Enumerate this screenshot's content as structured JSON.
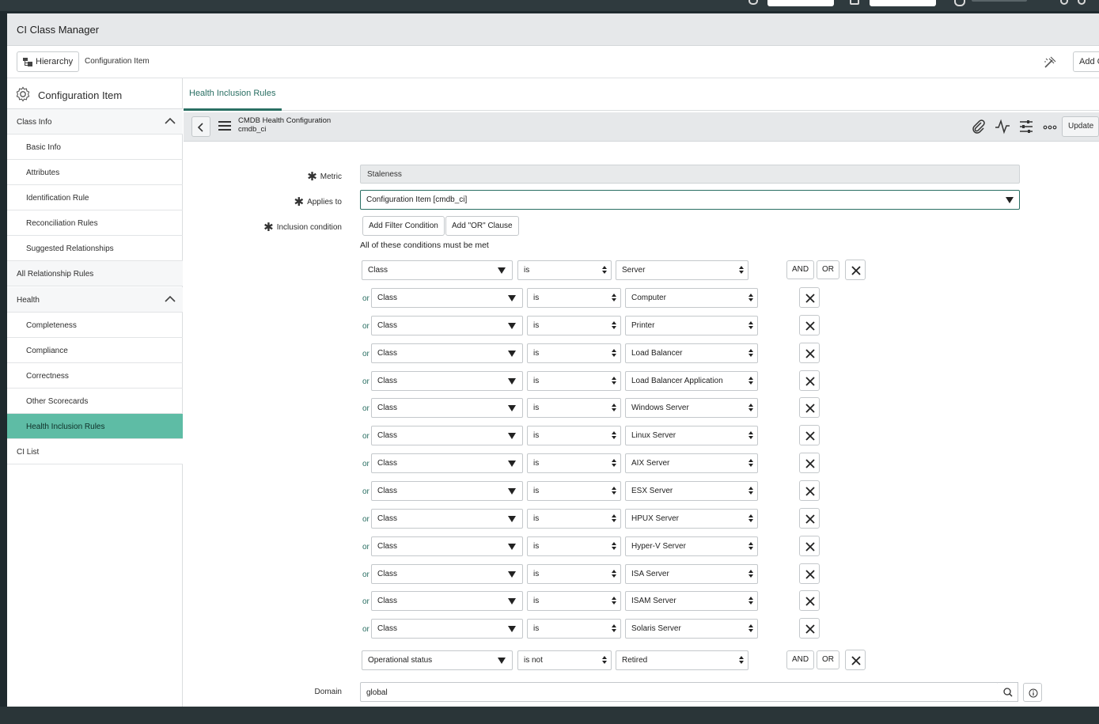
{
  "app": {
    "title": "CI Class Manager"
  },
  "breadcrumb": {
    "hierarchy_label": "Hierarchy",
    "current": "Configuration Item",
    "add_button": "Add C"
  },
  "sidebar": {
    "header": "Configuration Item",
    "items": [
      {
        "label": "Class Info",
        "type": "section",
        "expanded": true
      },
      {
        "label": "Basic Info",
        "type": "sub"
      },
      {
        "label": "Attributes",
        "type": "sub"
      },
      {
        "label": "Identification Rule",
        "type": "sub"
      },
      {
        "label": "Reconciliation Rules",
        "type": "sub"
      },
      {
        "label": "Suggested Relationships",
        "type": "sub"
      },
      {
        "label": "All Relationship Rules",
        "type": "section"
      },
      {
        "label": "Health",
        "type": "section",
        "expanded": true
      },
      {
        "label": "Completeness",
        "type": "sub"
      },
      {
        "label": "Compliance",
        "type": "sub"
      },
      {
        "label": "Correctness",
        "type": "sub"
      },
      {
        "label": "Other Scorecards",
        "type": "sub"
      },
      {
        "label": "Health Inclusion Rules",
        "type": "sub",
        "active": true
      },
      {
        "label": "CI List",
        "type": "section"
      }
    ]
  },
  "main": {
    "tab": "Health Inclusion Rules",
    "form_title": "CMDB Health Configuration",
    "form_subtitle": "cmdb_ci",
    "update_label": "Update"
  },
  "form": {
    "metric_label": "Metric",
    "metric_value": "Staleness",
    "applies_label": "Applies to",
    "applies_value": "Configuration Item [cmdb_ci]",
    "inclusion_label": "Inclusion condition",
    "add_filter_label": "Add Filter Condition",
    "add_or_label": "Add \"OR\" Clause",
    "conditions_text": "All of these conditions must be met",
    "or_label": "or",
    "and_btn": "AND",
    "or_btn": "OR",
    "domain_label": "Domain",
    "domain_value": "global"
  },
  "conditions": {
    "first": {
      "field": "Class",
      "operator": "is",
      "value": "Server"
    },
    "or_rows": [
      {
        "field": "Class",
        "operator": "is",
        "value": "Computer"
      },
      {
        "field": "Class",
        "operator": "is",
        "value": "Printer"
      },
      {
        "field": "Class",
        "operator": "is",
        "value": "Load Balancer"
      },
      {
        "field": "Class",
        "operator": "is",
        "value": "Load Balancer Application"
      },
      {
        "field": "Class",
        "operator": "is",
        "value": "Windows Server"
      },
      {
        "field": "Class",
        "operator": "is",
        "value": "Linux Server"
      },
      {
        "field": "Class",
        "operator": "is",
        "value": "AIX Server"
      },
      {
        "field": "Class",
        "operator": "is",
        "value": "ESX Server"
      },
      {
        "field": "Class",
        "operator": "is",
        "value": "HPUX Server"
      },
      {
        "field": "Class",
        "operator": "is",
        "value": "Hyper-V Server"
      },
      {
        "field": "Class",
        "operator": "is",
        "value": "ISA Server"
      },
      {
        "field": "Class",
        "operator": "is",
        "value": "ISAM Server"
      },
      {
        "field": "Class",
        "operator": "is",
        "value": "Solaris Server"
      }
    ],
    "last": {
      "field": "Operational status",
      "operator": "is not",
      "value": "Retired"
    }
  },
  "colors": {
    "accent": "#2a6f63",
    "active_item": "#5ebca5"
  },
  "icons": {
    "gear": "gear-icon",
    "chevron": "chevron-up-icon",
    "back": "chevron-left-icon",
    "menu": "hamburger-icon",
    "attach": "paperclip-icon",
    "activity": "activity-icon",
    "settings": "sliders-icon",
    "more": "more-icon",
    "close": "close-icon",
    "search": "search-icon",
    "info": "info-icon",
    "wand": "magic-wand-icon"
  }
}
